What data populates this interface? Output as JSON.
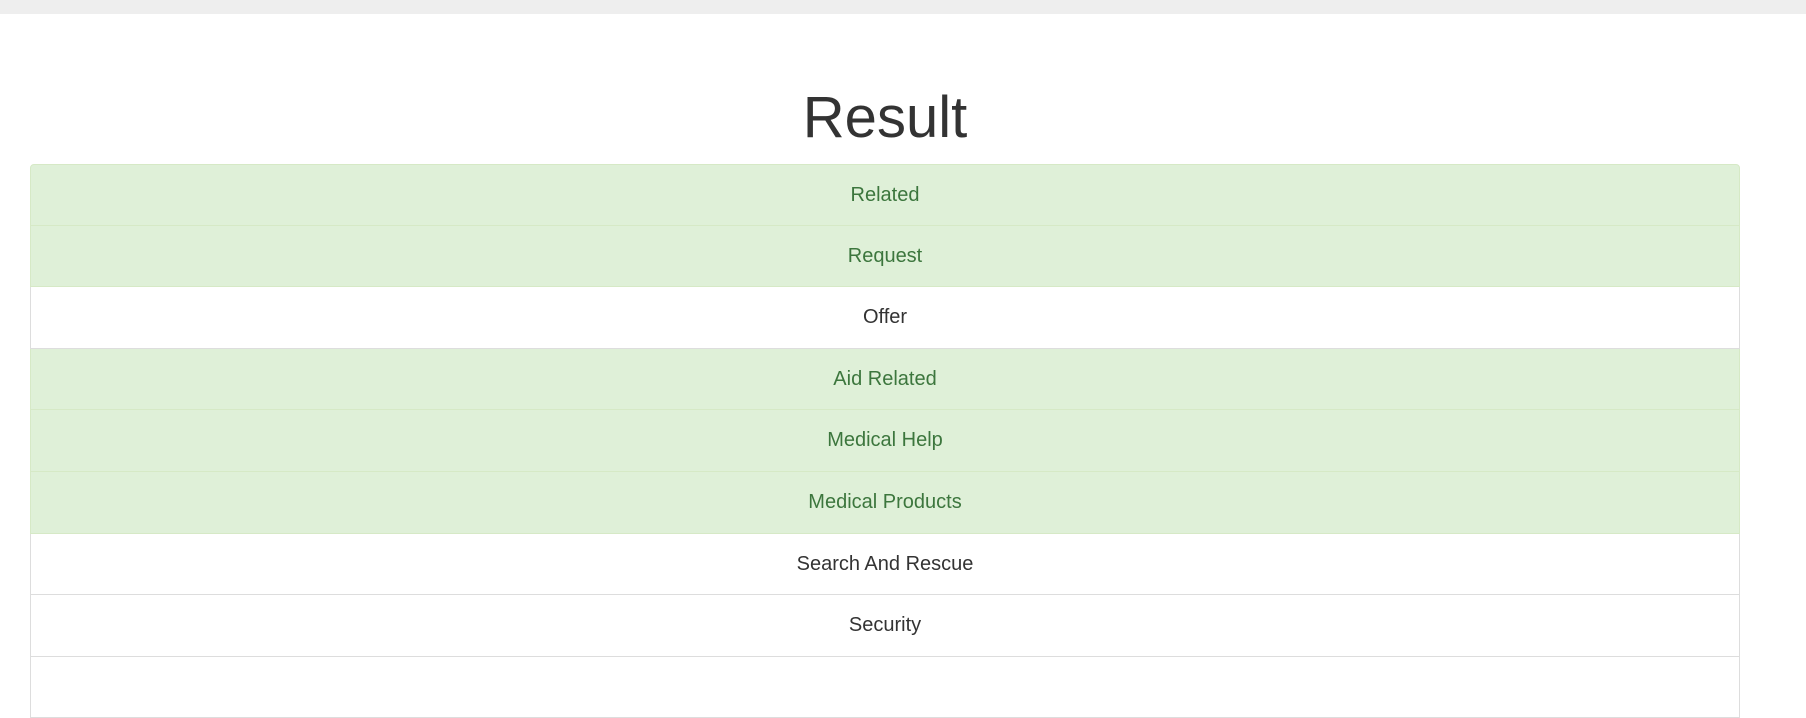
{
  "page": {
    "title": "Result"
  },
  "results": [
    {
      "label": "Related",
      "state": "success"
    },
    {
      "label": "Request",
      "state": "success"
    },
    {
      "label": "Offer",
      "state": "default"
    },
    {
      "label": "Aid Related",
      "state": "success"
    },
    {
      "label": "Medical Help",
      "state": "success"
    },
    {
      "label": "Medical Products",
      "state": "success"
    },
    {
      "label": "Search And Rescue",
      "state": "default"
    },
    {
      "label": "Security",
      "state": "default"
    },
    {
      "label": "",
      "state": "default"
    }
  ],
  "colors": {
    "success_background": "#dff0d8",
    "success_text": "#3c763d",
    "default_text": "#333333",
    "topbar": "#eeeeee"
  }
}
